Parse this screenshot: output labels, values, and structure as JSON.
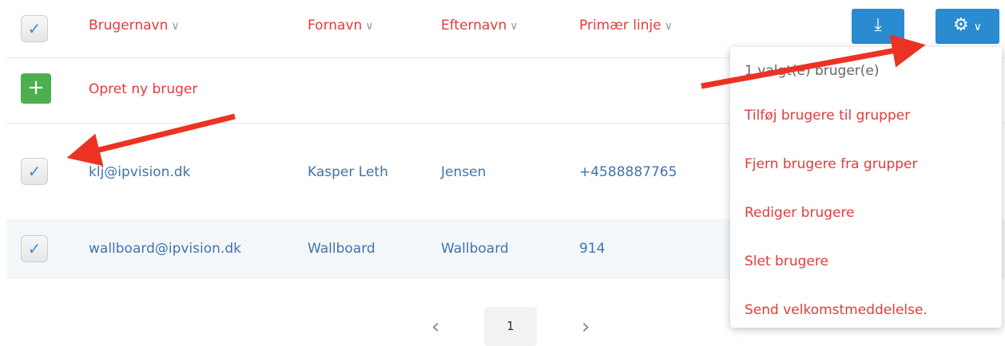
{
  "table": {
    "columns": [
      "Brugernavn",
      "Fornavn",
      "Efternavn",
      "Primær linje"
    ],
    "create_label": "Opret ny bruger",
    "rows": [
      {
        "username": "klj@ipvision.dk",
        "firstname": "Kasper Leth",
        "lastname": "Jensen",
        "line": "+4588887765",
        "checked": true
      },
      {
        "username": "wallboard@ipvision.dk",
        "firstname": "Wallboard",
        "lastname": "Wallboard",
        "line": "914",
        "checked": true
      }
    ]
  },
  "icons": {
    "check": "✓",
    "chevron": "∨",
    "plus": "+",
    "download": "⤓",
    "gear": "⚙",
    "prev": "‹",
    "next": "›"
  },
  "menu": {
    "info": "1 valgt(e) bruger(e)",
    "items": [
      "Tilføj brugere til grupper",
      "Fjern brugere fra grupper",
      "Rediger brugere",
      "Slet brugere",
      "Send velkomstmeddelelse."
    ]
  },
  "pagination": {
    "current": "1"
  },
  "colors": {
    "accent_red": "#e33b3b",
    "link_blue": "#3f74ad",
    "button_blue": "#2a8bd1",
    "button_green": "#4caf50",
    "annotation_arrow": "#ec3323"
  }
}
